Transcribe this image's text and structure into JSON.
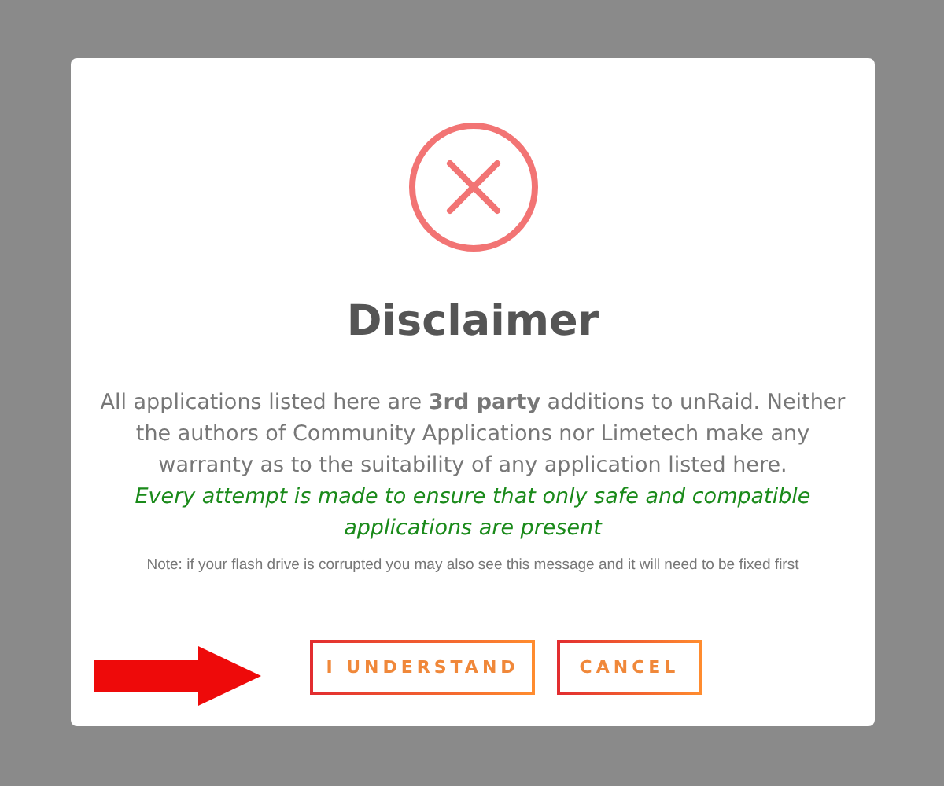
{
  "dialog": {
    "title": "Disclaimer",
    "message": "All applications listed here are **3rd party** additions to unRaid. Neither the authors of Community Applications nor Limetech make any warranty as to the suitability of any application listed here.",
    "notice": "Every attempt is made to ensure that only safe and compatible applications are present",
    "note": "Note: if your flash drive is corrupted you may also see this message and it will need to be fixed first",
    "buttons": [
      {
        "label": "I UNDERSTAND",
        "kind": "confirm"
      },
      {
        "label": "CANCEL",
        "kind": "cancel"
      }
    ]
  }
}
